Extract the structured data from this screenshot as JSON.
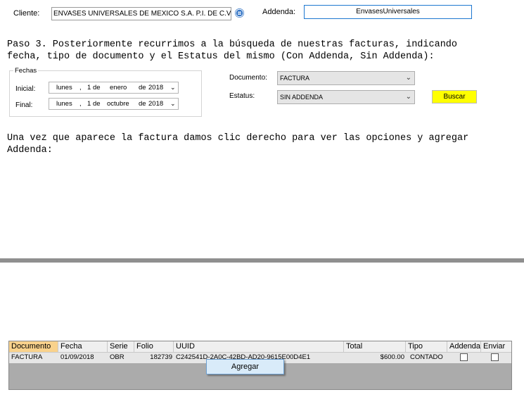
{
  "header": {
    "cliente_label": "Cliente:",
    "cliente_value": "ENVASES UNIVERSALES DE MEXICO S.A. P.I. DE C.V.",
    "addenda_label": "Addenda:",
    "addenda_value": "EnvasesUniversales"
  },
  "instructions": {
    "step3_line1": "Paso 3. Posteriormente recurrimos a la búsqueda de nuestras facturas, indicando",
    "step3_line2": "fecha, tipo de documento y el Estatus del mismo (Con Addenda, Sin Addenda):",
    "after_line1": "Una vez que aparece la factura damos clic derecho para ver las opciones y agregar",
    "after_line2": "Addenda:"
  },
  "filters": {
    "fechas_legend": "Fechas",
    "inicial_label": "Inicial:",
    "inicial_date": {
      "weekday": "lunes",
      "sep": ",",
      "day": "1",
      "de1": "de",
      "month": "enero",
      "de2": "de",
      "year": "2018"
    },
    "final_label": "Final:",
    "final_date": {
      "weekday": "lunes",
      "sep": ",",
      "day": "1",
      "de1": "de",
      "month": "octubre",
      "de2": "de",
      "year": "2018"
    },
    "documento_label": "Documento:",
    "documento_value": "FACTURA",
    "estatus_label": "Estatus:",
    "estatus_value": "SIN ADDENDA",
    "buscar_label": "Buscar",
    "buscar_color": "#ffff00"
  },
  "grid": {
    "columns": [
      "Documento",
      "Fecha",
      "Serie",
      "Folio",
      "UUID",
      "Total",
      "Tipo",
      "Addenda",
      "Enviar"
    ],
    "rows": [
      {
        "documento": "FACTURA",
        "fecha": "01/09/2018",
        "serie": "OBR",
        "folio": "182739",
        "uuid": "C242541D-2A0C-42BD-AD20-9615E00D4E1",
        "total": "$600.00",
        "tipo": "CONTADO",
        "addenda": false,
        "enviar": false
      }
    ]
  },
  "context_menu": {
    "agregar_label": "Agregar"
  },
  "colors": {
    "header_selected": "#f9d28c",
    "menu_bg": "#d9ebf9",
    "grid_empty": "#ababab",
    "separator": "#8f8f8f"
  }
}
